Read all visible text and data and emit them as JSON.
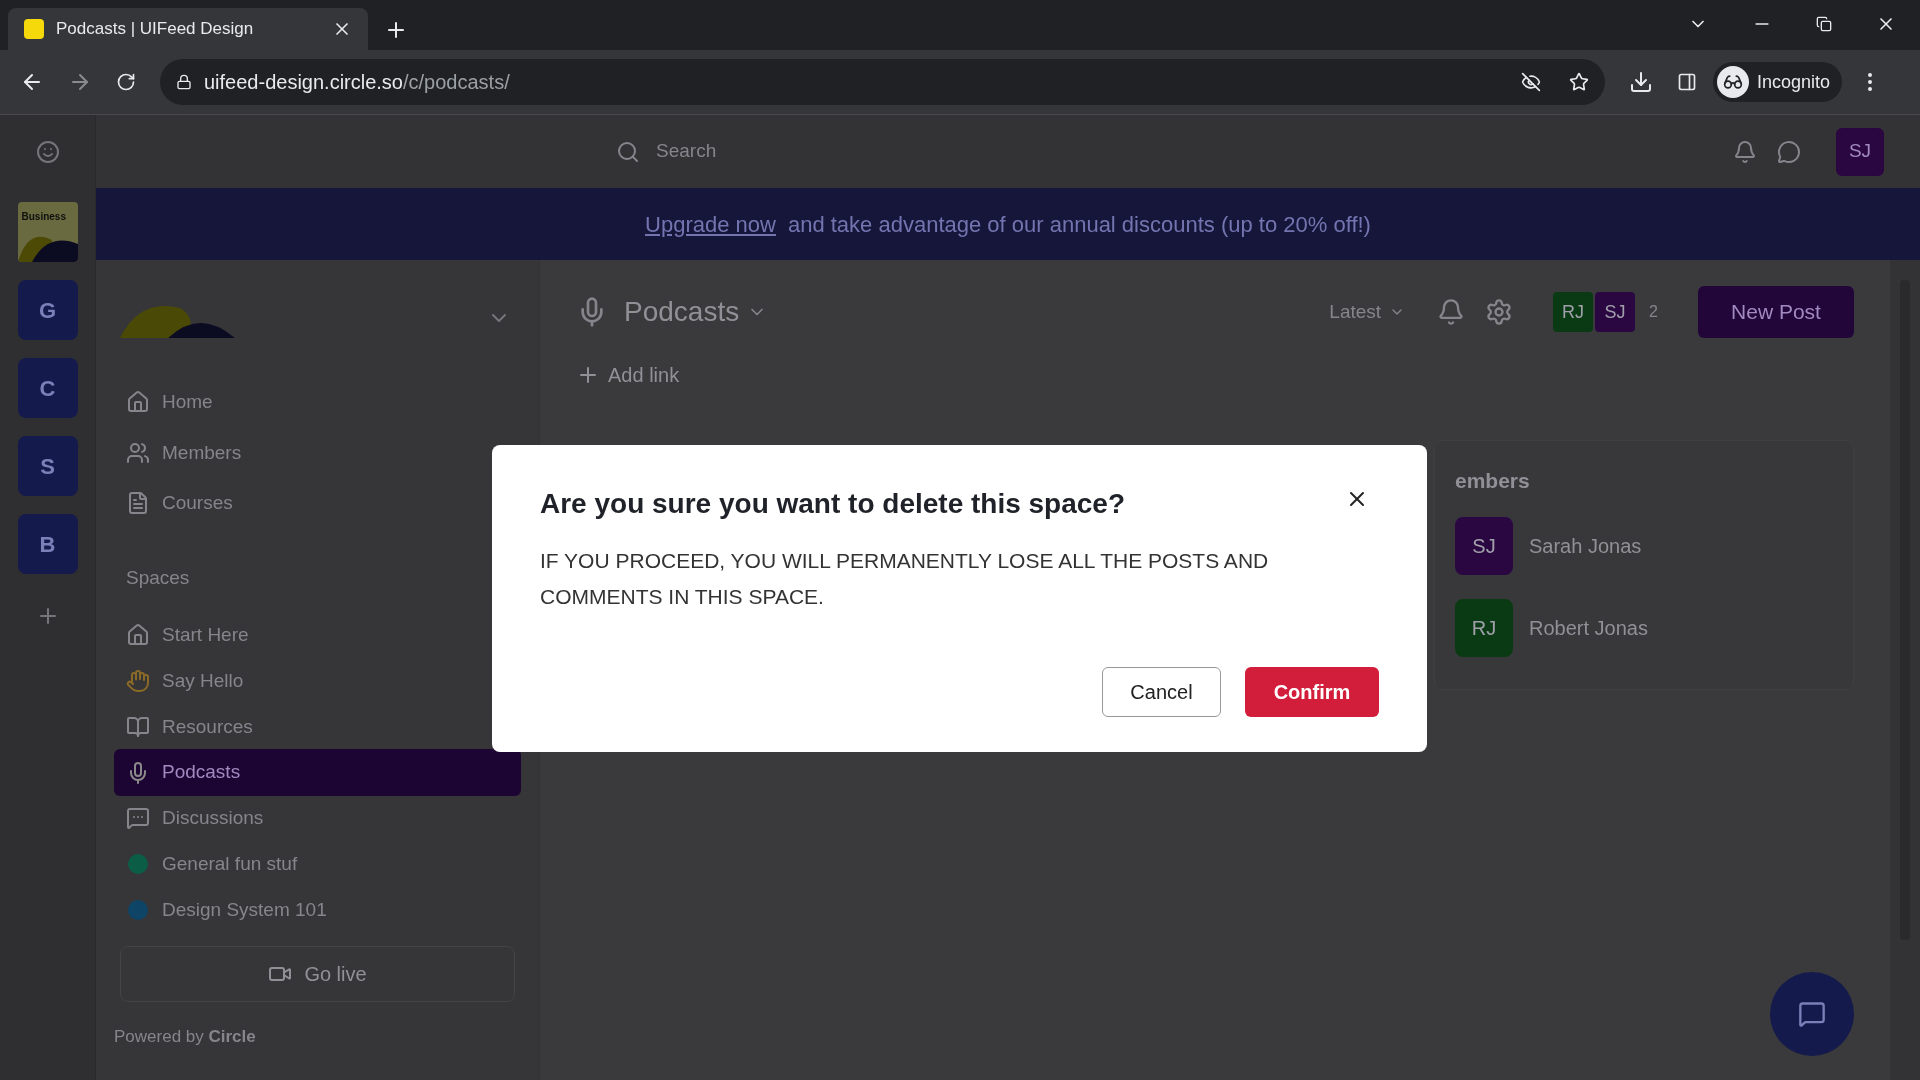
{
  "browser": {
    "tab_title": "Podcasts | UIFeed Design",
    "url_host": "uifeed-design.circle.so",
    "url_path": "/c/podcasts/",
    "profile": "Incognito"
  },
  "header": {
    "search_placeholder": "Search",
    "user_initials": "SJ"
  },
  "banner": {
    "link": "Upgrade now",
    "text": "and take advantage of our annual discounts (up to 20% off!)"
  },
  "communities": [
    {
      "kind": "thumbnail",
      "label": "Business"
    },
    {
      "kind": "letter",
      "label": "G"
    },
    {
      "kind": "letter",
      "label": "C"
    },
    {
      "kind": "letter",
      "label": "S"
    },
    {
      "kind": "letter",
      "label": "B"
    }
  ],
  "nav": [
    {
      "label": "Home"
    },
    {
      "label": "Members"
    },
    {
      "label": "Courses"
    }
  ],
  "spaces_heading": "Spaces",
  "spaces": [
    {
      "label": "Start Here",
      "kind": "house",
      "selected": false
    },
    {
      "label": "Say Hello",
      "kind": "hands",
      "selected": false
    },
    {
      "label": "Resources",
      "kind": "book",
      "selected": false
    },
    {
      "label": "Podcasts",
      "kind": "mic",
      "selected": true
    },
    {
      "label": "Discussions",
      "kind": "chat",
      "selected": false
    },
    {
      "label": "General fun stuf",
      "kind": "dot",
      "color": "#0b5e45",
      "selected": false
    },
    {
      "label": "Design System 101",
      "kind": "dot",
      "color": "#0e4466",
      "selected": false
    }
  ],
  "go_live": "Go live",
  "powered_by": "Powered by **Circle**",
  "main": {
    "title": "Podcasts",
    "sort": "Latest",
    "avatars": [
      {
        "initials": "RJ",
        "color": "#0a3a14"
      },
      {
        "initials": "SJ",
        "color": "#2b0742"
      }
    ],
    "member_count": "2",
    "new_post": "New Post",
    "add_link": "Add link"
  },
  "members_panel": {
    "title": "embers",
    "members": [
      {
        "initials": "SJ",
        "name": "Sarah Jonas",
        "color": "#2b0742"
      },
      {
        "initials": "RJ",
        "name": "Robert Jonas",
        "color": "#0a3a14"
      }
    ]
  },
  "modal": {
    "title": "Are you sure you want to delete this space?",
    "body": "IF YOU PROCEED, YOU WILL PERMANENTLY LOSE ALL THE POSTS AND COMMENTS IN THIS SPACE.",
    "cancel": "Cancel",
    "confirm": "Confirm"
  }
}
